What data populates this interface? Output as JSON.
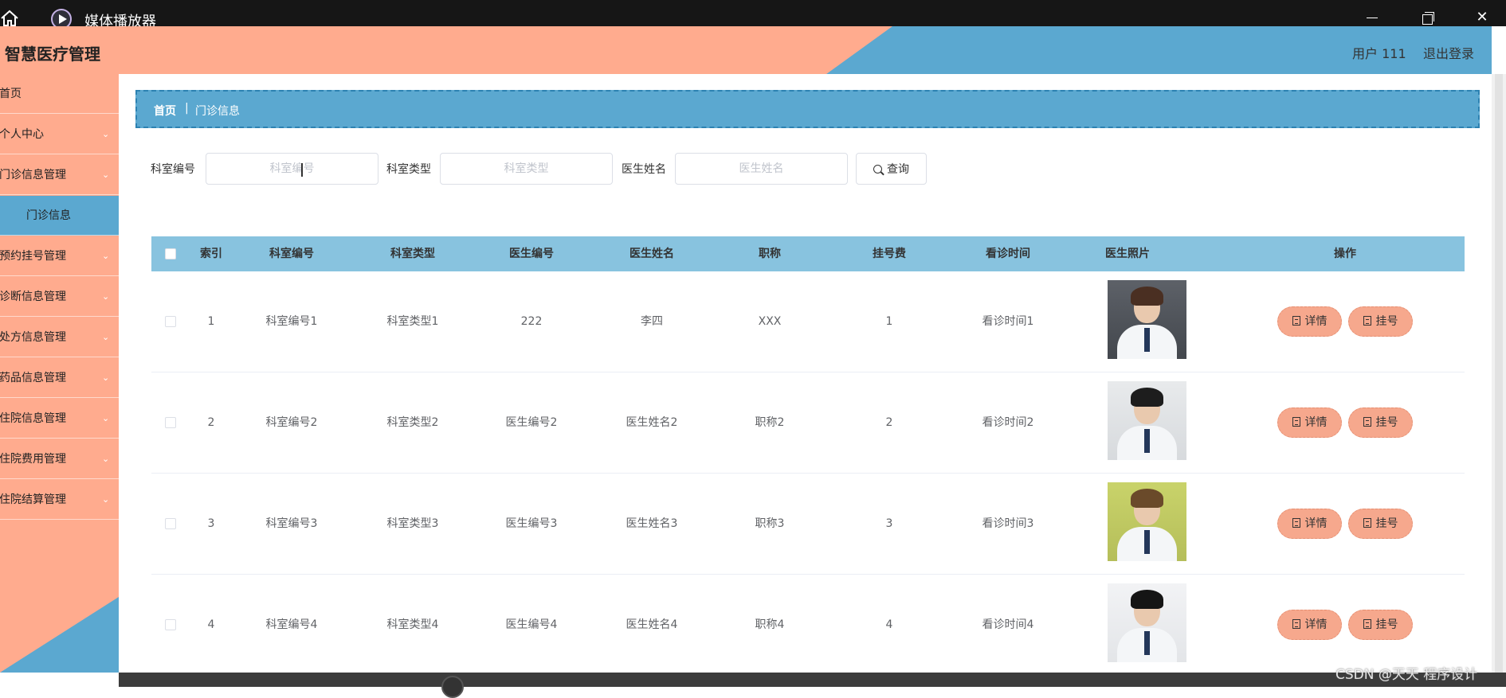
{
  "window": {
    "title": "媒体播放器"
  },
  "header": {
    "logo": "智慧医疗管理",
    "user": "用户 111",
    "logout": "退出登录"
  },
  "sidebar": {
    "items": [
      {
        "label": "首页",
        "shown": "首页",
        "has_children": false
      },
      {
        "label": "个人中心",
        "shown": "个人中心",
        "has_children": true
      },
      {
        "label": "门诊信息管理",
        "shown": "门诊信息管理",
        "has_children": true
      },
      {
        "label": "门诊信息",
        "shown": "门诊信息",
        "has_children": false,
        "active": true
      },
      {
        "label": "预约挂号管理",
        "shown": "预约挂号管理",
        "has_children": true
      },
      {
        "label": "诊断信息管理",
        "shown": "诊断信息管理",
        "has_children": true
      },
      {
        "label": "处方信息管理",
        "shown": "处方信息管理",
        "has_children": true
      },
      {
        "label": "药品信息管理",
        "shown": "药品信息管理",
        "has_children": true
      },
      {
        "label": "住院信息管理",
        "shown": "住院信息管理",
        "has_children": true
      },
      {
        "label": "住院费用管理",
        "shown": "住院费用管理",
        "has_children": true
      },
      {
        "label": "住院结算管理",
        "shown": "住院结算管理",
        "has_children": true
      }
    ]
  },
  "breadcrumb": {
    "home": "首页",
    "separator": "|",
    "current": "门诊信息"
  },
  "search": {
    "fields": [
      {
        "label": "科室编号",
        "placeholder": "科室编号"
      },
      {
        "label": "科室类型",
        "placeholder": "科室类型"
      },
      {
        "label": "医生姓名",
        "placeholder": "医生姓名"
      }
    ],
    "button": "查询"
  },
  "table": {
    "columns": [
      "索引",
      "科室编号",
      "科室类型",
      "医生编号",
      "医生姓名",
      "职称",
      "挂号费",
      "看诊时间",
      "医生照片",
      "操作"
    ],
    "rows": [
      {
        "index": "1",
        "dept_no": "科室编号1",
        "dept_type": "科室类型1",
        "doctor_no": "222",
        "doctor_name": "李四",
        "title": "XXX",
        "fee": "1",
        "time": "看诊时间1"
      },
      {
        "index": "2",
        "dept_no": "科室编号2",
        "dept_type": "科室类型2",
        "doctor_no": "医生编号2",
        "doctor_name": "医生姓名2",
        "title": "职称2",
        "fee": "2",
        "time": "看诊时间2"
      },
      {
        "index": "3",
        "dept_no": "科室编号3",
        "dept_type": "科室类型3",
        "doctor_no": "医生编号3",
        "doctor_name": "医生姓名3",
        "title": "职称3",
        "fee": "3",
        "time": "看诊时间3"
      },
      {
        "index": "4",
        "dept_no": "科室编号4",
        "dept_type": "科室类型4",
        "doctor_no": "医生编号4",
        "doctor_name": "医生姓名4",
        "title": "职称4",
        "fee": "4",
        "time": "看诊时间4"
      }
    ],
    "actions": {
      "detail": "详情",
      "register": "挂号"
    }
  },
  "watermark": "CSDN @天天 程序设计",
  "colors": {
    "peach": "#ffab8e",
    "blue": "#5ba8d0",
    "table_header": "#88c3df",
    "button": "#f6a88d"
  }
}
